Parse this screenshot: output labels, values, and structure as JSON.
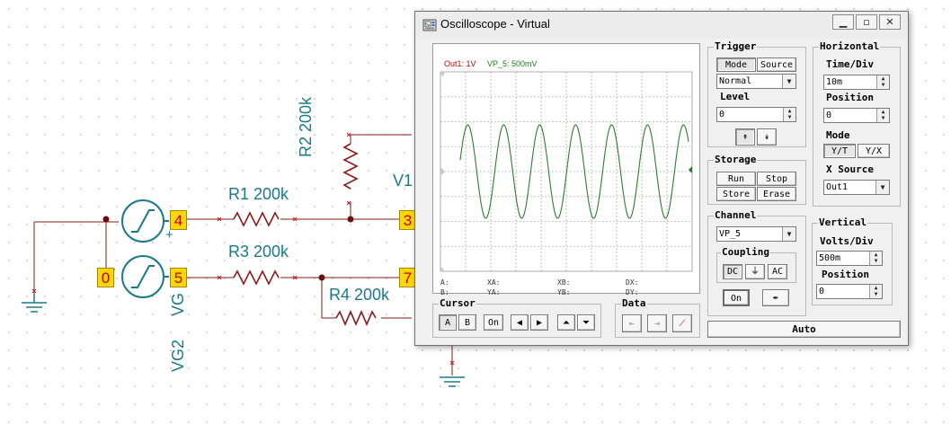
{
  "window": {
    "title": "Oscilloscope - Virtual",
    "controls": [
      "minimize",
      "restore",
      "close"
    ]
  },
  "schematic": {
    "labels": {
      "r1": "R1 200k",
      "r2": "R2 200k",
      "r3": "R3 200k",
      "r4": "R4 200k",
      "v1": "V1",
      "vg": "VG",
      "vg2": "VG2",
      "plus": "+"
    },
    "nodes": {
      "n4": "4",
      "n0": "0",
      "n5": "5",
      "n3": "3",
      "n7": "7"
    }
  },
  "screen": {
    "legend_ch1": "Out1: 1V",
    "legend_ch2": "VP_5: 500mV",
    "ch1_color": "#c00000",
    "ch2_color": "#1e7a1e",
    "trace_color": "#2e7d2e",
    "cursor_readout": {
      "a": "A:",
      "xa": "XA:",
      "xb": "XB:",
      "dx": "DX:",
      "b": "B:",
      "ya": "YA:",
      "yb": "YB:",
      "dy": "DY:"
    }
  },
  "trigger": {
    "title": "Trigger",
    "mode_tab": "Mode",
    "source_tab": "Source",
    "mode_value": "Normal",
    "level_label": "Level",
    "level_value": "0"
  },
  "storage": {
    "title": "Storage",
    "run": "Run",
    "stop": "Stop",
    "store": "Store",
    "erase": "Erase"
  },
  "horizontal": {
    "title": "Horizontal",
    "time_div_label": "Time/Div",
    "time_div_value": "10m",
    "position_label": "Position",
    "position_value": "0",
    "mode_label": "Mode",
    "yt": "Y/T",
    "xy": "Y/X",
    "xsource_label": "X Source",
    "xsource_value": "Out1"
  },
  "channel": {
    "title": "Channel",
    "value": "VP_5",
    "coupling_label": "Coupling",
    "dc": "DC",
    "ac": "AC",
    "on": "On"
  },
  "vertical": {
    "title": "Vertical",
    "volts_div_label": "Volts/Div",
    "volts_div_value": "500m",
    "position_label": "Position",
    "position_value": "0"
  },
  "cursor": {
    "title": "Cursor",
    "a": "A",
    "b": "B",
    "on": "On"
  },
  "data_group": {
    "title": "Data"
  },
  "auto": "Auto"
}
